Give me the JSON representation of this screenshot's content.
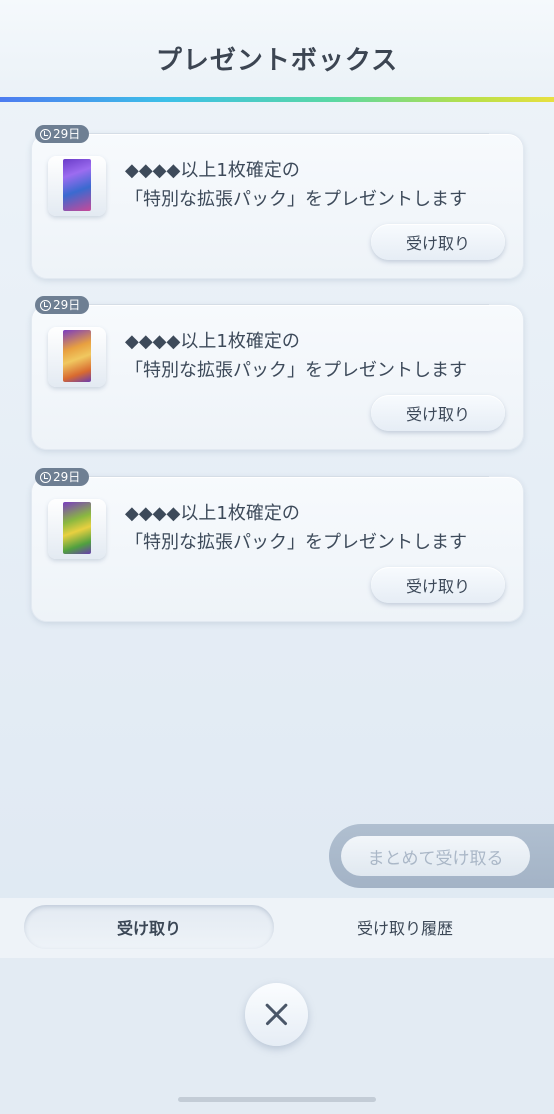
{
  "header": {
    "title": "プレゼントボックス"
  },
  "presents": [
    {
      "days": "29日",
      "line1": "◆◆◆◆以上1枚確定の",
      "line2": "「特別な拡張パック」をプレゼントします",
      "claim_label": "受け取り",
      "pack_icon": "pack-purple-icon"
    },
    {
      "days": "29日",
      "line1": "◆◆◆◆以上1枚確定の",
      "line2": "「特別な拡張パック」をプレゼントします",
      "claim_label": "受け取り",
      "pack_icon": "pack-orange-icon"
    },
    {
      "days": "29日",
      "line1": "◆◆◆◆以上1枚確定の",
      "line2": "「特別な拡張パック」をプレゼントします",
      "claim_label": "受け取り",
      "pack_icon": "pack-green-icon"
    }
  ],
  "bulk": {
    "label": "まとめて受け取る"
  },
  "tabs": [
    {
      "label": "受け取り",
      "active": true
    },
    {
      "label": "受け取り履歴",
      "active": false
    }
  ],
  "icons": {
    "close": "close-icon",
    "clock": "clock-icon"
  },
  "colors": {
    "accent_start": "#4d7cf0",
    "accent_end": "#e8e040",
    "badge": "#6e7f93"
  }
}
